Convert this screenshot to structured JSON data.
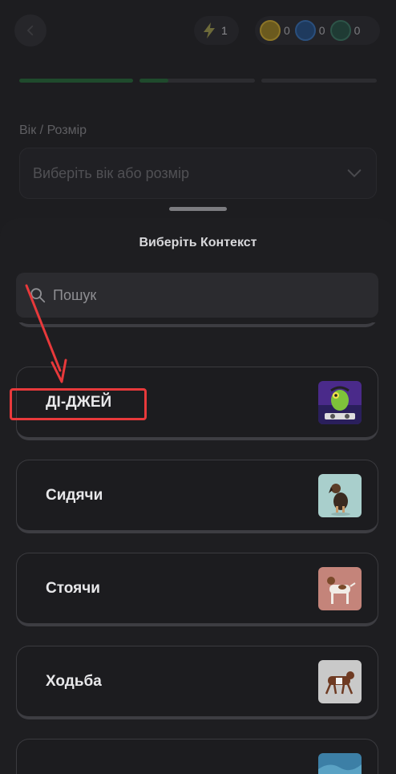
{
  "header": {
    "energy_count": "1",
    "coins": [
      {
        "icon": "gold-coin-icon",
        "value": "0",
        "color": "#8c7527"
      },
      {
        "icon": "blue-coin-icon",
        "value": "0",
        "color": "#2a4f7d"
      },
      {
        "icon": "green-coin-icon",
        "value": "0",
        "color": "#2d5448"
      }
    ]
  },
  "form": {
    "age_label": "Вік / Розмір",
    "age_placeholder": "Виберіть вік або розмір"
  },
  "sheet": {
    "title": "Виберіть Контекст",
    "search_placeholder": "Пошук",
    "items": [
      {
        "label": "ДІ-ДЖЕЙ",
        "thumb": "dj-lizard-image"
      },
      {
        "label": "Сидячи",
        "thumb": "sitting-dog-image"
      },
      {
        "label": "Стоячи",
        "thumb": "standing-dog-image"
      },
      {
        "label": "Ходьба",
        "thumb": "walking-dog-image"
      },
      {
        "label": "",
        "thumb": "partial-image"
      }
    ]
  },
  "colors": {
    "accent_red": "#e8393b",
    "progress_green": "#1f4a2c"
  }
}
